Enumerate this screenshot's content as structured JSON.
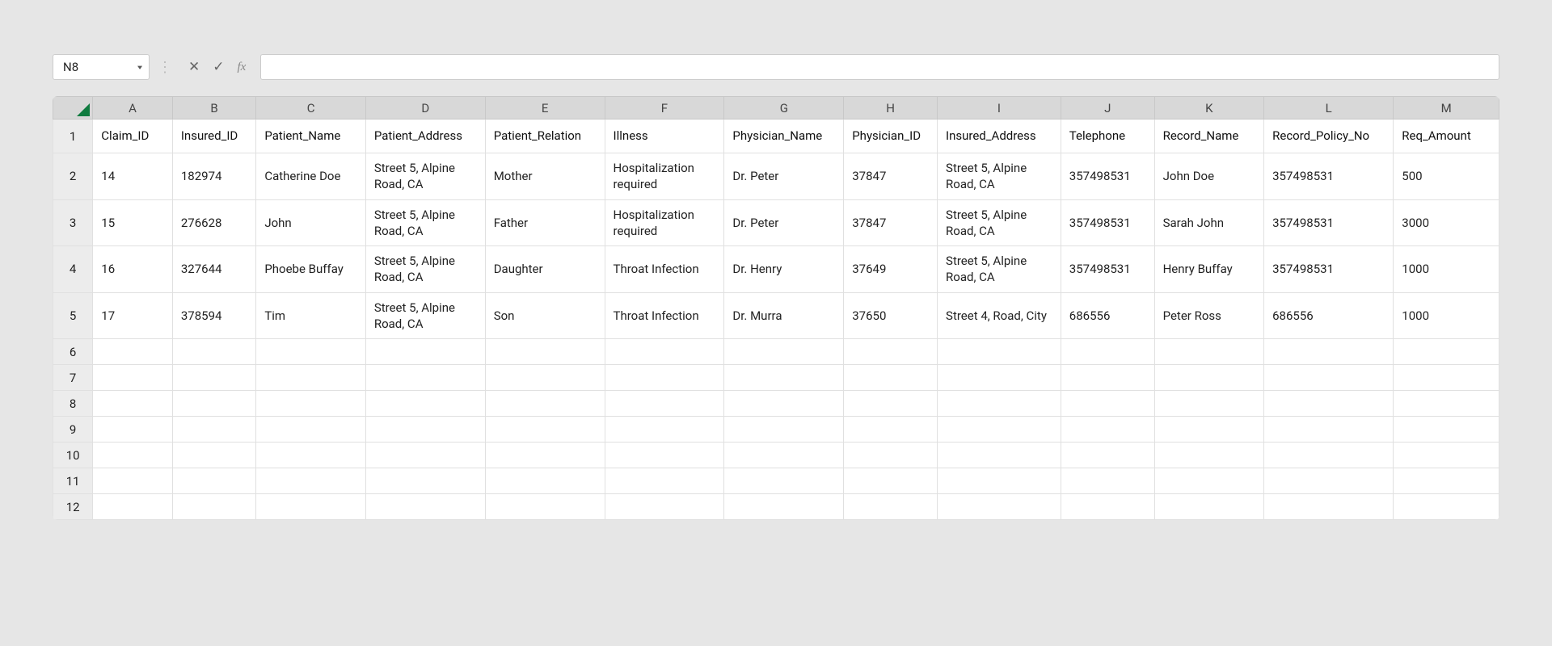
{
  "namebox": {
    "value": "N8"
  },
  "formula": {
    "value": ""
  },
  "icons": {
    "cancel": "✕",
    "confirm": "✓",
    "fx": "fx",
    "caret": "▾"
  },
  "columns": [
    "A",
    "B",
    "C",
    "D",
    "E",
    "F",
    "G",
    "H",
    "I",
    "J",
    "K",
    "L",
    "M"
  ],
  "row_numbers": [
    "1",
    "2",
    "3",
    "4",
    "5",
    "6",
    "7",
    "8",
    "9",
    "10",
    "11",
    "12"
  ],
  "headers": {
    "A": "Claim_ID",
    "B": "Insured_ID",
    "C": "Patient_Name",
    "D": "Patient_Address",
    "E": "Patient_Relation",
    "F": "Illness",
    "G": "Physician_Name",
    "H": "Physician_ID",
    "I": "Insured_Address",
    "J": "Telephone",
    "K": "Record_Name",
    "L": "Record_Policy_No",
    "M": "Req_Amount"
  },
  "rows": [
    {
      "A": "14",
      "B": "182974",
      "C": "Catherine Doe",
      "D": "Street 5, Alpine Road, CA",
      "E": "Mother",
      "F": "Hospitalization required",
      "G": "Dr. Peter",
      "H": "37847",
      "I": "Street 5, Alpine Road, CA",
      "J": "357498531",
      "K": "John Doe",
      "L": "357498531",
      "M": "500"
    },
    {
      "A": "15",
      "B": "276628",
      "C": "John",
      "D": "Street 5, Alpine Road, CA",
      "E": "Father",
      "F": "Hospitalization required",
      "G": "Dr. Peter",
      "H": "37847",
      "I": "Street 5, Alpine Road, CA",
      "J": "357498531",
      "K": "Sarah John",
      "L": "357498531",
      "M": "3000"
    },
    {
      "A": "16",
      "B": "327644",
      "C": "Phoebe Buffay",
      "D": "Street 5, Alpine Road, CA",
      "E": "Daughter",
      "F": "Throat Infection",
      "G": "Dr. Henry",
      "H": "37649",
      "I": "Street 5, Alpine Road, CA",
      "J": "357498531",
      "K": "Henry Buffay",
      "L": "357498531",
      "M": "1000"
    },
    {
      "A": "17",
      "B": "378594",
      "C": "Tim",
      "D": "Street 5, Alpine Road, CA",
      "E": "Son",
      "F": "Throat Infection",
      "G": "Dr. Murra",
      "H": "37650",
      "I": "Street 4, Road, City",
      "J": "686556",
      "K": "Peter Ross",
      "L": "686556",
      "M": "1000"
    }
  ],
  "empty_row_count": 7
}
